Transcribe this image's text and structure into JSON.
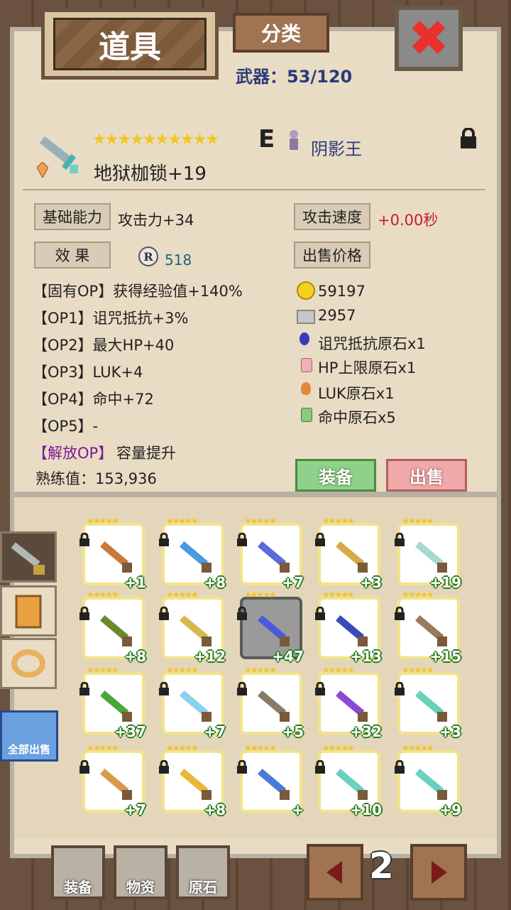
{
  "header": {
    "title": "道具",
    "category_button": "分类",
    "weapon_count": "武器：53/120"
  },
  "item": {
    "stars": "★★★★★★★★★★",
    "grade": "E",
    "owner": "阴影王",
    "name": "地狱枷锁+19"
  },
  "stats": {
    "basic_label": "基础能力",
    "attack": "攻击力+34",
    "speed_label": "攻击速度",
    "speed_value": "+0.00秒",
    "effect_label": "效 果",
    "r_value": "518",
    "sell_price_label": "出售价格",
    "options": [
      "【固有OP】获得经验值+140%",
      "【OP1】诅咒抵抗+3%",
      "【OP2】最大HP+40",
      "【OP3】LUK+4",
      "【OP4】命中+72",
      "【OP5】-"
    ],
    "release_label": "【解放OP】",
    "release_value": "容量提升",
    "proficiency": "熟练值：153,936",
    "gold": "59197",
    "silver": "2957",
    "materials": [
      "诅咒抵抗原石x1",
      "HP上限原石x1",
      "LUK原石x1",
      "命中原石x5"
    ]
  },
  "actions": {
    "equip": "装备",
    "sell": "出售"
  },
  "side": {
    "sell_all": "全部出售"
  },
  "grid": [
    {
      "level": "+1",
      "color": "#c87a3a"
    },
    {
      "level": "+8",
      "color": "#4a9ae0"
    },
    {
      "level": "+7",
      "color": "#5a6ad8"
    },
    {
      "level": "+3",
      "color": "#d8a84a"
    },
    {
      "level": "+19",
      "color": "#a8d8d0"
    },
    {
      "level": "+8",
      "color": "#6a8a2a"
    },
    {
      "level": "+12",
      "color": "#d8b84a"
    },
    {
      "level": "+47",
      "color": "#4a5ad8"
    },
    {
      "level": "+13",
      "color": "#3a4ab8"
    },
    {
      "level": "+15",
      "color": "#9a7a5a"
    },
    {
      "level": "+37",
      "color": "#4aa83a"
    },
    {
      "level": "+7",
      "color": "#8ad0f0"
    },
    {
      "level": "+5",
      "color": "#8a7a6a"
    },
    {
      "level": "+32",
      "color": "#8a4ad8"
    },
    {
      "level": "+3",
      "color": "#6ad0b8"
    },
    {
      "level": "+7",
      "color": "#d89a4a"
    },
    {
      "level": "+8",
      "color": "#e8b83a"
    },
    {
      "level": "+",
      "color": "#4a7ad8"
    },
    {
      "level": "+10",
      "color": "#6ad0c0"
    },
    {
      "level": "+9",
      "color": "#6ad0c0"
    }
  ],
  "bottom": {
    "equip": "装备",
    "goods": "物资",
    "ore": "原石",
    "page": "2"
  }
}
